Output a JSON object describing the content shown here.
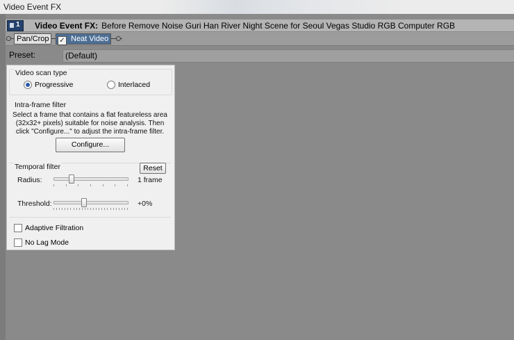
{
  "window": {
    "title": "Video Event FX"
  },
  "fx_header": {
    "badge": "1",
    "prefix": "Video Event FX:",
    "clip_name": "Before Remove Noise Guri Han River Night Scene for Seoul Vegas Studio RGB Computer RGB"
  },
  "chain": {
    "plugins": [
      {
        "label": "Pan/Crop",
        "active": false
      },
      {
        "label": "Neat Video",
        "active": true,
        "enabled": true
      }
    ]
  },
  "preset": {
    "label": "Preset:",
    "value": "(Default)"
  },
  "scan_type": {
    "title": "Video scan type",
    "options": [
      {
        "label": "Progressive",
        "selected": true
      },
      {
        "label": "Interlaced",
        "selected": false
      }
    ]
  },
  "intra_filter": {
    "title": "Intra-frame filter",
    "description": "Select a frame that contains a flat featureless area (32x32+ pixels) suitable for noise analysis. Then click \"Configure...\" to adjust the intra-frame filter.",
    "configure_label": "Configure..."
  },
  "temporal_filter": {
    "title": "Temporal filter",
    "reset_label": "Reset",
    "radius": {
      "label": "Radius:",
      "value_text": "1 frame",
      "fraction": 0.24
    },
    "threshold": {
      "label": "Threshold:",
      "value_text": "+0%",
      "fraction": 0.41
    }
  },
  "options": {
    "adaptive_filtration": {
      "label": "Adaptive Filtration",
      "checked": false
    },
    "no_lag_mode": {
      "label": "No Lag Mode",
      "checked": false
    }
  },
  "colors": {
    "selected_plugin": "#4d6f95",
    "panel_bg": "#f0f0f0",
    "workspace": "#8a8a8a"
  },
  "icons": {
    "badge_icon": "event-fx-icon",
    "checkbox_icon": "checkmark-icon",
    "connector_icon": "chain-connector-icon"
  }
}
